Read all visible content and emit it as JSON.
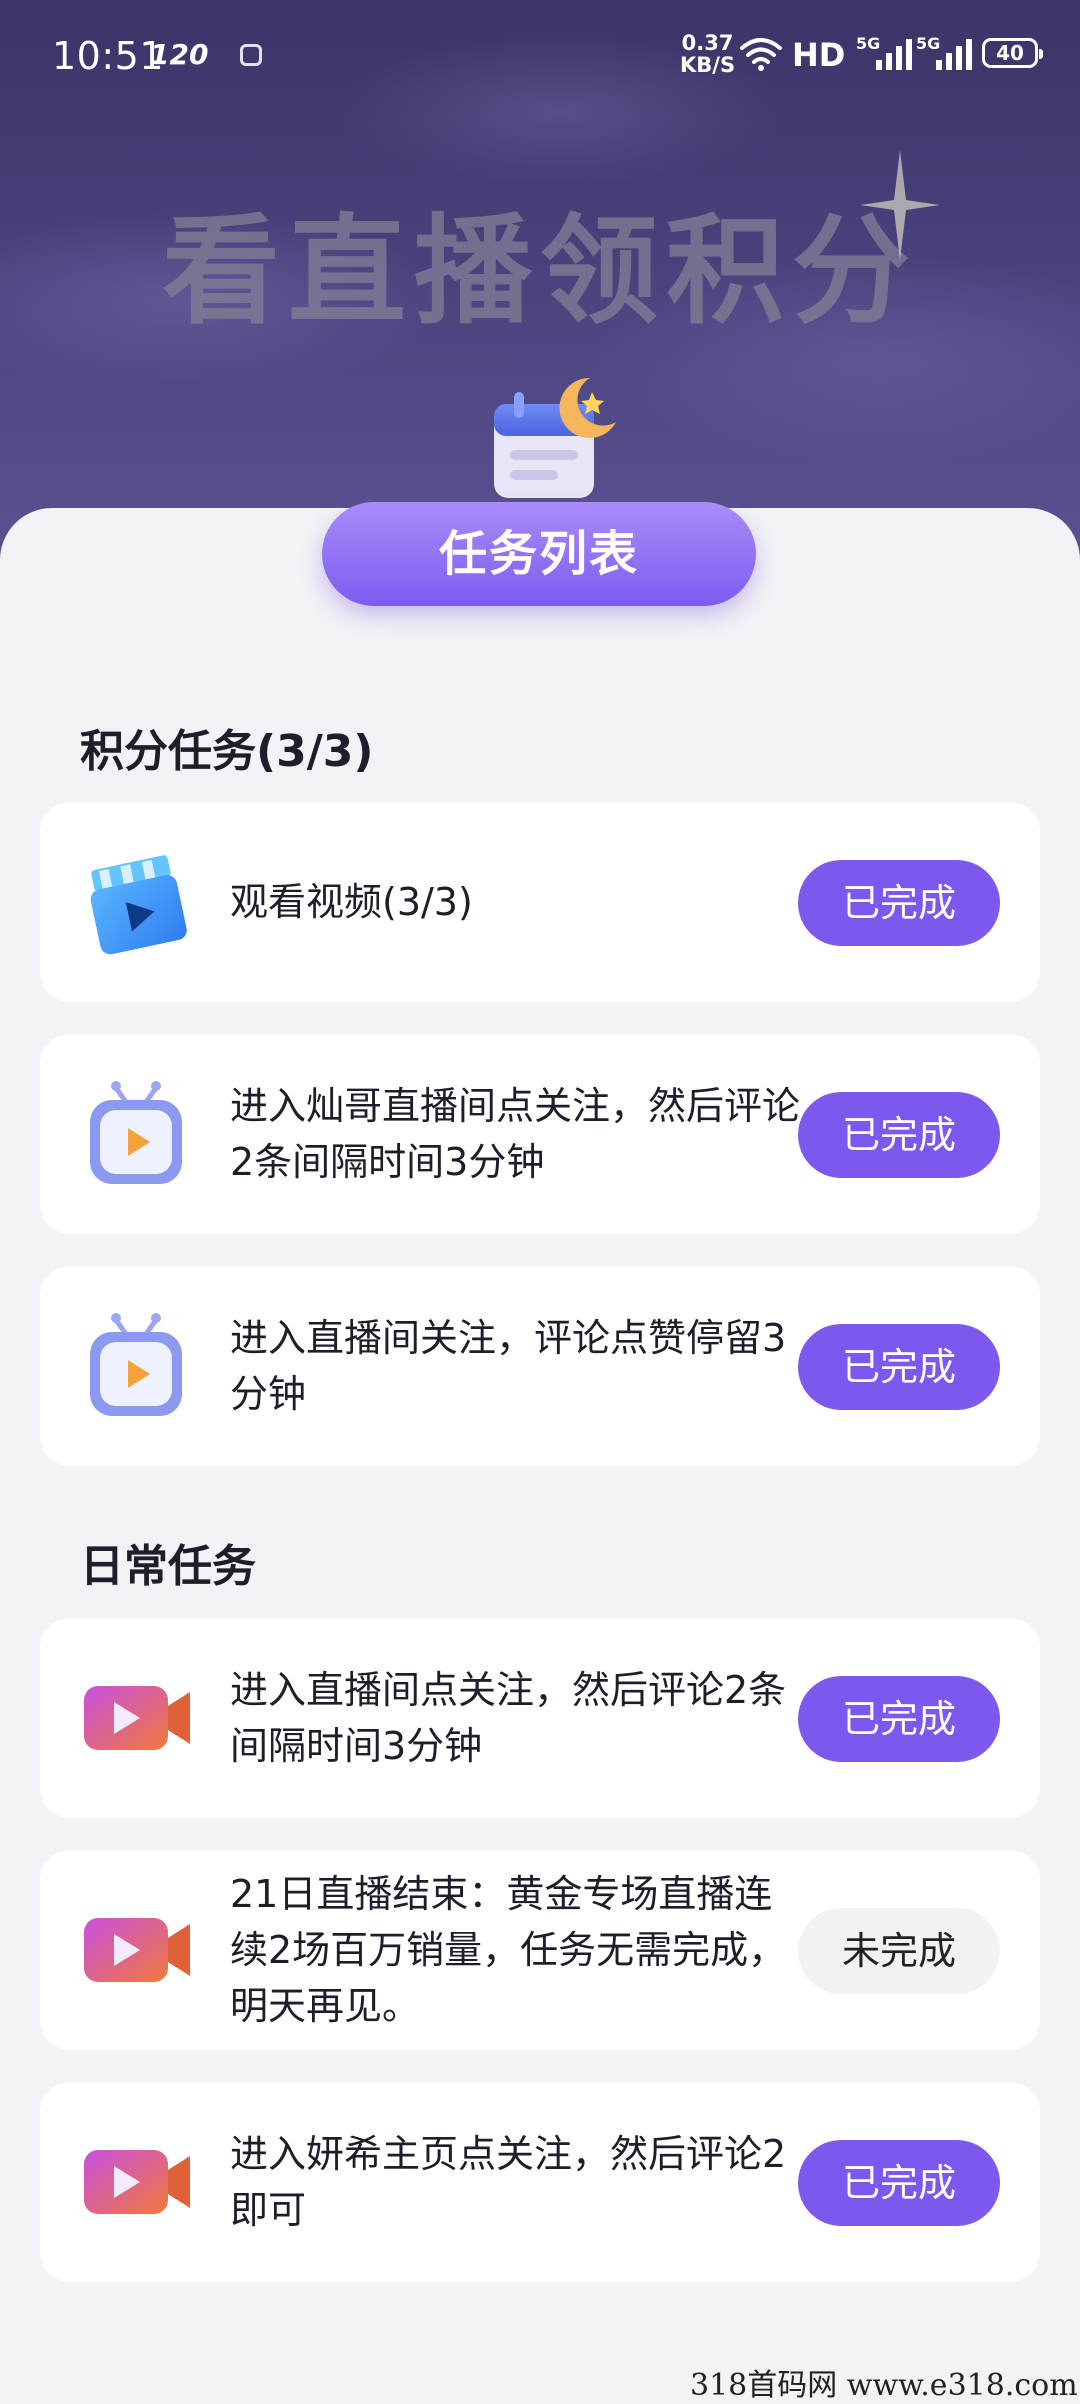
{
  "status_bar": {
    "time": "10:51",
    "refresh_rate": "120",
    "net_speed_value": "0.37",
    "net_speed_unit": "KB/S",
    "hd_label": "HD",
    "network_1": "5G",
    "network_2": "5G",
    "battery": "40"
  },
  "banner": {
    "title": "看直播领积分"
  },
  "tab": {
    "label": "任务列表"
  },
  "sections": [
    {
      "title": "积分任务(3/3)",
      "tasks": [
        {
          "icon": "video-clapper-icon",
          "text": "观看视频(3/3)",
          "status": "已完成"
        },
        {
          "icon": "tv-play-icon",
          "text": "进入灿哥直播间点关注，然后评论2条间隔时间3分钟",
          "status": "已完成"
        },
        {
          "icon": "tv-play-icon",
          "text": "进入直播间关注，评论点赞停留3分钟",
          "status": "已完成"
        }
      ]
    },
    {
      "title": "日常任务",
      "tasks": [
        {
          "icon": "video-camera-icon",
          "text": "进入直播间点关注，然后评论2条间隔时间3分钟",
          "status": "已完成"
        },
        {
          "icon": "video-camera-icon",
          "text": "21日直播结束：黄金专场直播连续2场百万销量，任务无需完成，明天再见。",
          "status": "未完成"
        },
        {
          "icon": "video-camera-icon",
          "text": "进入妍希主页点关注，然后评论2即可",
          "status": "已完成"
        }
      ]
    }
  ],
  "watermark": "318首码网  www.e318.com",
  "colors": {
    "accent": "#7c58ef",
    "hero_bg": "#3a3468",
    "page_bg": "#f3f2f6"
  }
}
